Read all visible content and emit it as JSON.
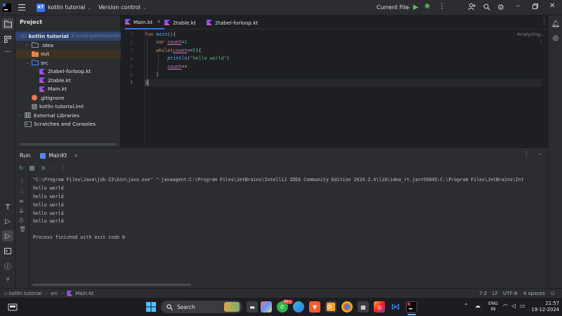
{
  "titlebar": {
    "project_badge": "KT",
    "project_name": "kotlin tutorial",
    "vcs_label": "Version control",
    "run_config": "Current File",
    "icons": [
      "menu-icon",
      "run-icon",
      "debug-icon",
      "more-icon",
      "add-user-icon",
      "search-icon",
      "settings-icon",
      "minimize-icon",
      "restore-icon",
      "close-icon"
    ]
  },
  "project_panel": {
    "title": "Project",
    "tree": [
      {
        "label": "kotlin tutorial",
        "hint": "E:\\coding\\kotlin\\kotlin",
        "level": 0,
        "expanded": true,
        "type": "module"
      },
      {
        "label": ".idea",
        "level": 1,
        "expanded": false,
        "type": "folder"
      },
      {
        "label": "out",
        "level": 1,
        "expanded": false,
        "type": "excluded-folder"
      },
      {
        "label": "src",
        "level": 1,
        "expanded": true,
        "type": "source-folder"
      },
      {
        "label": "2tabel-forloop.kt",
        "level": 2,
        "type": "kotlin-file"
      },
      {
        "label": "2table.kt",
        "level": 2,
        "type": "kotlin-file"
      },
      {
        "label": "Main.kt",
        "level": 2,
        "type": "kotlin-file"
      },
      {
        "label": ".gitignore",
        "level": 1,
        "type": "git-file"
      },
      {
        "label": "kotlin tutorial.iml",
        "level": 1,
        "type": "iml-file"
      },
      {
        "label": "External Libraries",
        "level": 0,
        "expanded": false,
        "type": "library"
      },
      {
        "label": "Scratches and Consoles",
        "level": 0,
        "type": "scratch"
      }
    ]
  },
  "editor": {
    "tabs": [
      {
        "label": "Main.kt",
        "active": true
      },
      {
        "label": "2table.kt",
        "active": false
      },
      {
        "label": "2tabel-forloop.kt",
        "active": false
      }
    ],
    "status": "Analyzing...",
    "line_numbers": [
      "1",
      "2",
      "3",
      "4",
      "5",
      "6",
      "7"
    ],
    "code": {
      "l1_kw": "fun",
      "l1_fn": "main",
      "l1_rest": "(){",
      "l2_kw": "var",
      "l2_var": "count",
      "l2_eq": "=",
      "l2_num": "1",
      "l3_kw": "while",
      "l3_open": "(",
      "l3_var": "count",
      "l3_op": "<=",
      "l3_num": "5",
      "l3_close": "){",
      "l4_fn": "println",
      "l4_open": "(",
      "l4_str": "\"hello world\"",
      "l4_close": ")",
      "l5_var": "count",
      "l5_op": "++",
      "l6": "}",
      "l7": "}"
    }
  },
  "run_panel": {
    "title": "Run",
    "tab_label": "MainKt",
    "console_lines": [
      "\"C:\\Program Files\\Java\\jdk-23\\bin\\java.exe\" \"-javaagent:C:\\Program Files\\JetBrains\\IntelliJ IDEA Community Edition 2024.2.4\\lib\\idea_rt.jar=50845:C:\\Program Files\\JetBrains\\Int",
      "hello world",
      "hello world",
      "hello world",
      "hello world",
      "hello world",
      "",
      "Process finished with exit code 0"
    ]
  },
  "statusbar": {
    "breadcrumb": [
      "kotlin tutorial",
      "src",
      "Main.kt"
    ],
    "position": "7:2",
    "line_sep": "LF",
    "encoding": "UTF-8",
    "indent": "4 spaces"
  },
  "taskbar": {
    "search_placeholder": "Search",
    "lang_top": "ENG",
    "lang_bottom": "IN",
    "time": "21:57",
    "date": "19-12-2024",
    "notification_badge": "99+"
  },
  "colors": {
    "accent": "#3574f0",
    "bg_dark": "#1e1f22",
    "panel": "#2b2d30",
    "keyword": "#cf8e6d",
    "function": "#56a8f5",
    "string": "#6aab73",
    "number": "#2aacb8",
    "variable": "#c77dbb"
  }
}
